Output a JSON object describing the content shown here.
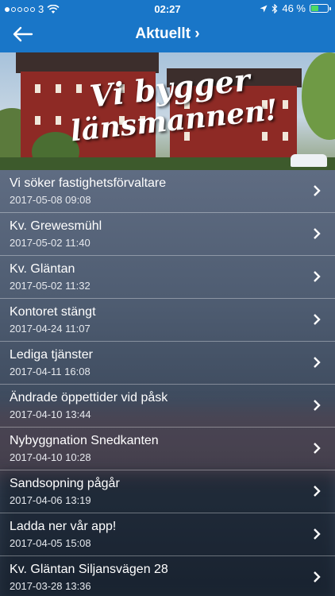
{
  "status_bar": {
    "carrier": "3",
    "time": "02:27",
    "battery_percent": "46 %",
    "battery_level": 0.46,
    "signal_bars_filled": 1,
    "signal_bars_total": 5
  },
  "nav": {
    "back_icon": "back-arrow-icon",
    "title": "Aktuellt ›"
  },
  "banner": {
    "line1": "Vi bygger",
    "line2": "länsmannen!"
  },
  "news": [
    {
      "title": "Vi söker fastighetsförvaltare",
      "date": "2017-05-08 09:08"
    },
    {
      "title": "Kv. Grewesmühl",
      "date": "2017-05-02 11:40"
    },
    {
      "title": "Kv. Gläntan",
      "date": "2017-05-02 11:32"
    },
    {
      "title": "Kontoret stängt",
      "date": "2017-04-24 11:07"
    },
    {
      "title": "Lediga tjänster",
      "date": "2017-04-11 16:08"
    },
    {
      "title": "Ändrade öppettider vid påsk",
      "date": "2017-04-10 13:44"
    },
    {
      "title": "Nybyggnation Snedkanten",
      "date": "2017-04-10 10:28"
    },
    {
      "title": "Sandsopning pågår",
      "date": "2017-04-06 13:19"
    },
    {
      "title": "Ladda ner vår app!",
      "date": "2017-04-05 15:08"
    },
    {
      "title": "Kv. Gläntan Siljansvägen 28",
      "date": "2017-03-28 13:36"
    }
  ],
  "colors": {
    "nav_blue": "#1976c8",
    "battery_green": "#4cd964"
  }
}
